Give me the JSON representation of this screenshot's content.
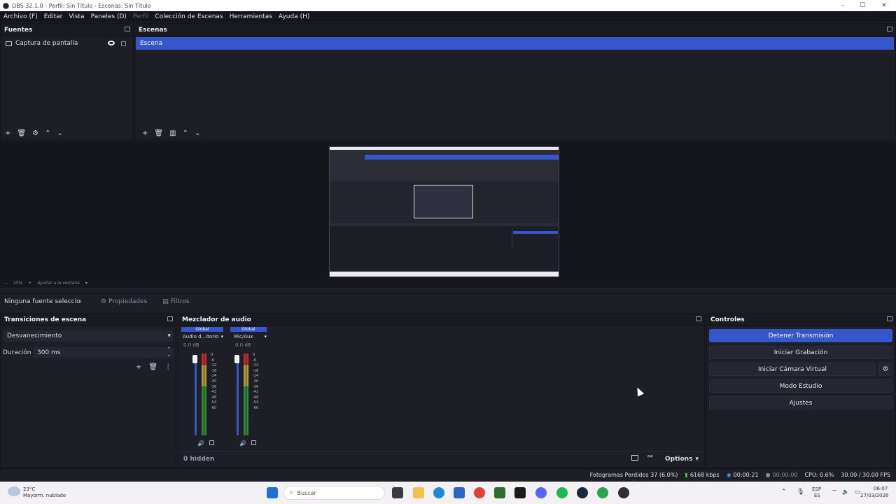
{
  "window": {
    "title": "OBS 32.1.0 - Perfil: Sin Título - Escenas: Sin Título"
  },
  "menu": {
    "items": [
      "Archivo (F)",
      "Editar",
      "Vista",
      "Paneles (D)",
      "Perfil",
      "Colección de Escenas",
      "Herramientas",
      "Ayuda (H)"
    ]
  },
  "sources": {
    "title": "Fuentes",
    "items": [
      {
        "label": "Captura de pantalla",
        "icon": "monitor-icon"
      }
    ]
  },
  "scenes": {
    "title": "Escenas",
    "items": [
      {
        "label": "Escena",
        "selected": true
      }
    ]
  },
  "preview": {
    "zoom": "25%",
    "fit_label": "Ajustar a la ventana"
  },
  "source_bar": {
    "no_source": "Ninguna fuente seleccionada",
    "properties": "Propiedades",
    "filters": "Filtros"
  },
  "transitions": {
    "title": "Transiciones de escena",
    "type": "Desvanecimiento",
    "duration_label": "Duración",
    "duration_value": "300 ms"
  },
  "mixer": {
    "title": "Mezclador de audio",
    "channels": [
      {
        "badge": "Global",
        "name": "Audio d...itorio",
        "db": "0.0 dB"
      },
      {
        "badge": "Global",
        "name": "Mic/Aux",
        "db": "0.0 dB"
      }
    ],
    "scale": [
      "0",
      "-6",
      "-12",
      "-18",
      "-24",
      "-30",
      "-36",
      "-42",
      "-48",
      "-54",
      "-60"
    ],
    "hidden": "0 hidden",
    "options": "Options"
  },
  "controls": {
    "title": "Controles",
    "buttons": [
      "Detener Transmisión",
      "Iniciar Grabación",
      "Iniciar Cámara Virtual",
      "Modo Estudio",
      "Ajustes"
    ]
  },
  "status": {
    "dropped": "Fotogramas Perdidos 37 (6.0%)",
    "bitrate": "6168 kbps",
    "stream_time": "00:00:21",
    "rec_time": "00:00:00",
    "cpu": "CPU: 0.6%",
    "fps": "30.00 / 30.00 FPS"
  },
  "taskbar": {
    "weather_temp": "23°C",
    "weather_desc": "Mayorm. nublado",
    "search": "Buscar",
    "lang": "ESP",
    "lang2": "ES",
    "time": "06:07",
    "date": "27/03/2026"
  },
  "colors": {
    "accent": "#3657cc",
    "bg": "#1e1f26"
  }
}
